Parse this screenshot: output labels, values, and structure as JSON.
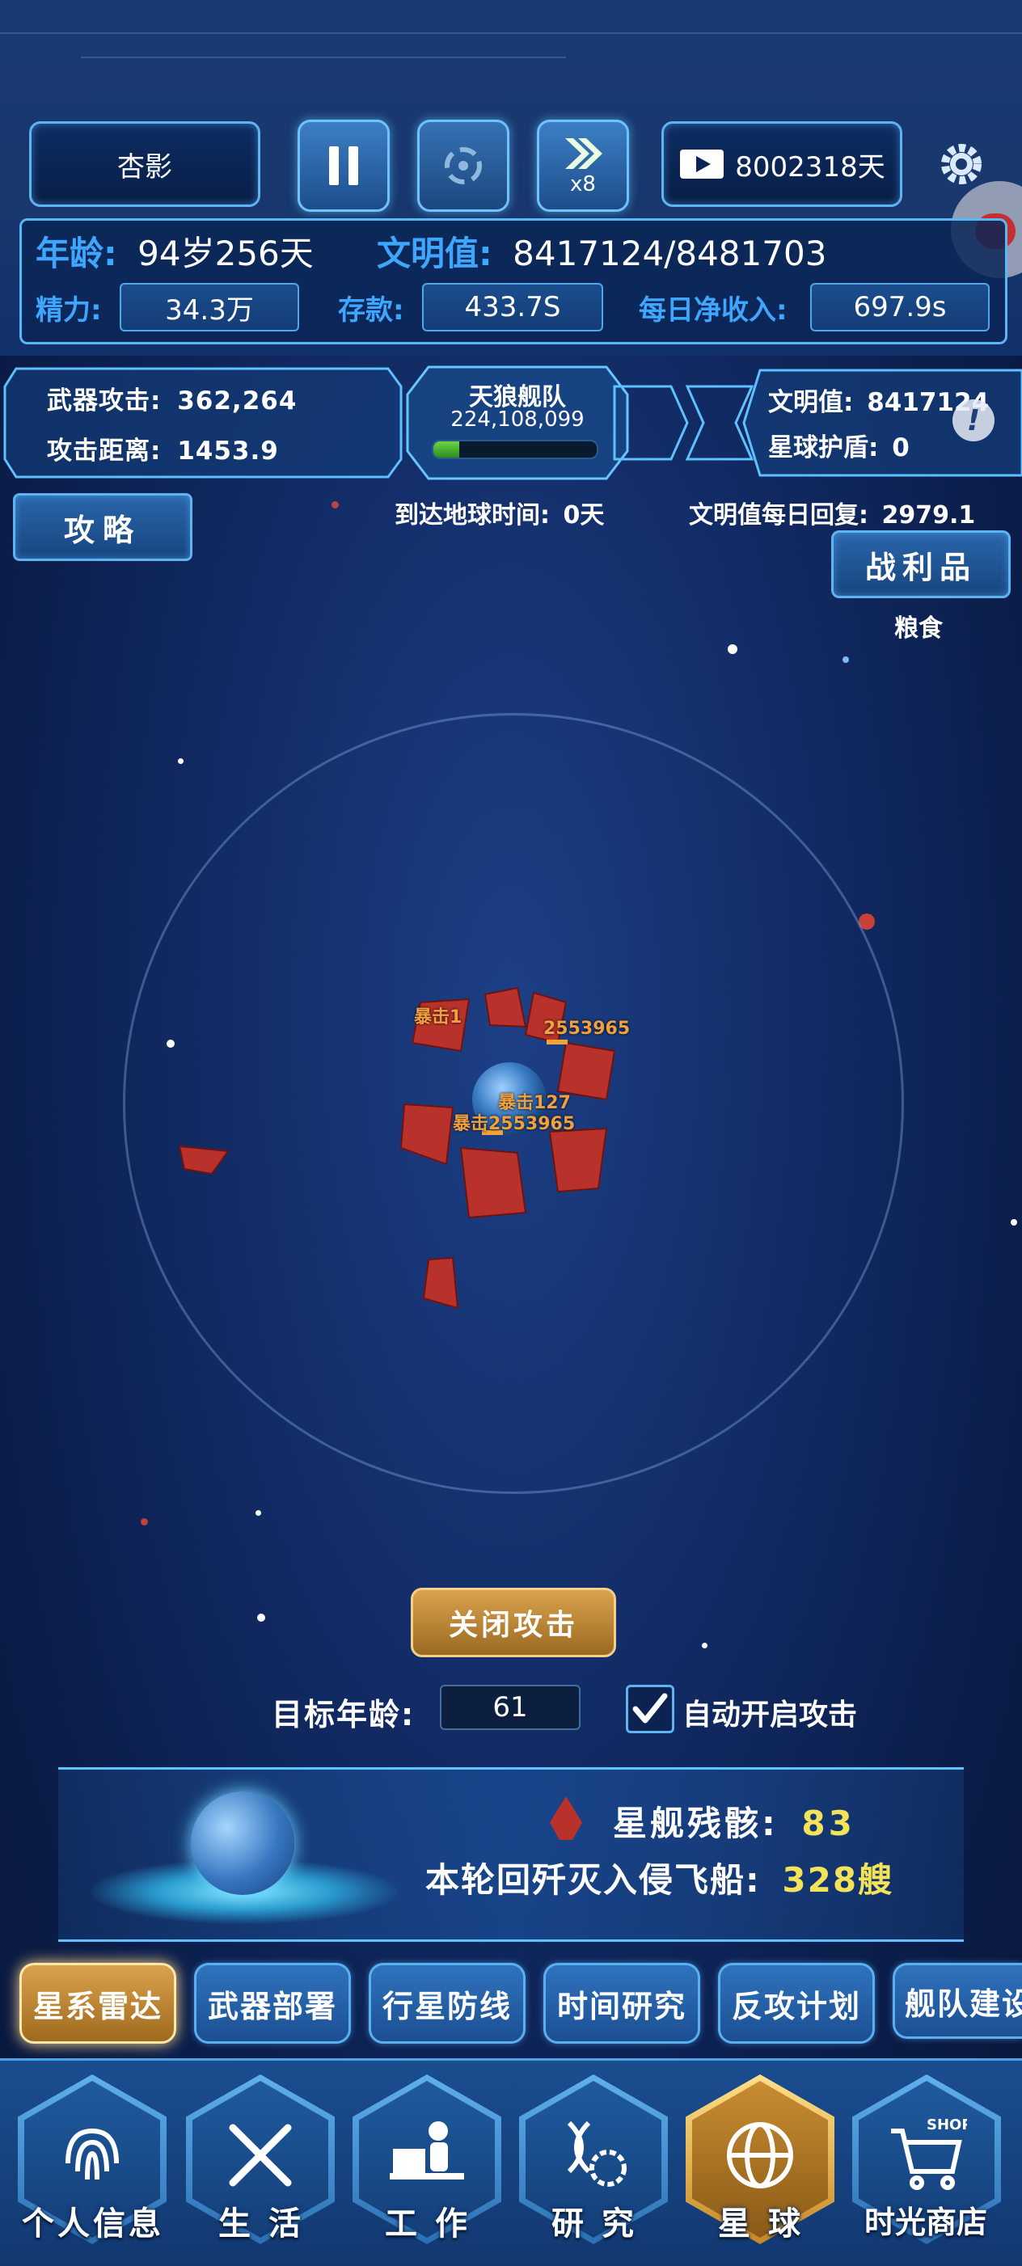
{
  "header": {
    "player_name": "杏影",
    "speed_label": "x8",
    "days_counter": "8002318天",
    "age_label": "年龄:",
    "age_value": "94岁256天",
    "civ_label": "文明值:",
    "civ_value": "8417124/8481703",
    "energy_label": "精力:",
    "energy_value": "34.3万",
    "savings_label": "存款:",
    "savings_value": "433.7S",
    "income_label": "每日净收入:",
    "income_value": "697.9s"
  },
  "battle_bar": {
    "weapon_attack_label": "武器攻击:",
    "weapon_attack_value": "362,264",
    "attack_range_label": "攻击距离:",
    "attack_range_value": "1453.9",
    "fleet_name": "天狼舰队",
    "fleet_hp": "224,108,099",
    "fleet_hp_fraction": 0.16,
    "planet_civ_label": "文明值:",
    "planet_civ_value": "8417124",
    "planet_shield_label": "星球护盾:",
    "planet_shield_value": "0"
  },
  "info": {
    "guide_button": "攻略",
    "arrival_label": "到达地球时间:",
    "arrival_value": "0天",
    "civ_regen_label": "文明值每日回复:",
    "civ_regen_value": "2979.1",
    "loot_button": "战利品",
    "loot_item": "粮食"
  },
  "battle": {
    "damage_texts": [
      "暴击1",
      "2553965",
      "暴击127",
      "暴击2553965"
    ]
  },
  "controls": {
    "close_attack_button": "关闭攻击",
    "target_age_label": "目标年龄:",
    "target_age_value": "61",
    "auto_attack_label": "自动开启攻击",
    "auto_attack_checked": true
  },
  "summary": {
    "wreckage_label": "星舰残骸:",
    "wreckage_value": "83",
    "destroyed_label": "本轮回歼灭入侵飞船:",
    "destroyed_value": "328艘"
  },
  "tabs": [
    "星系雷达",
    "武器部署",
    "行星防线",
    "时间研究",
    "反攻计划",
    "舰队建设"
  ],
  "nav": [
    "个人信息",
    "生 活",
    "工 作",
    "研 究",
    "星 球",
    "时光商店"
  ],
  "colors": {
    "accent_blue": "#3fa6ff",
    "gold": "#d9a24d",
    "yellow_value": "#f3e35a"
  }
}
